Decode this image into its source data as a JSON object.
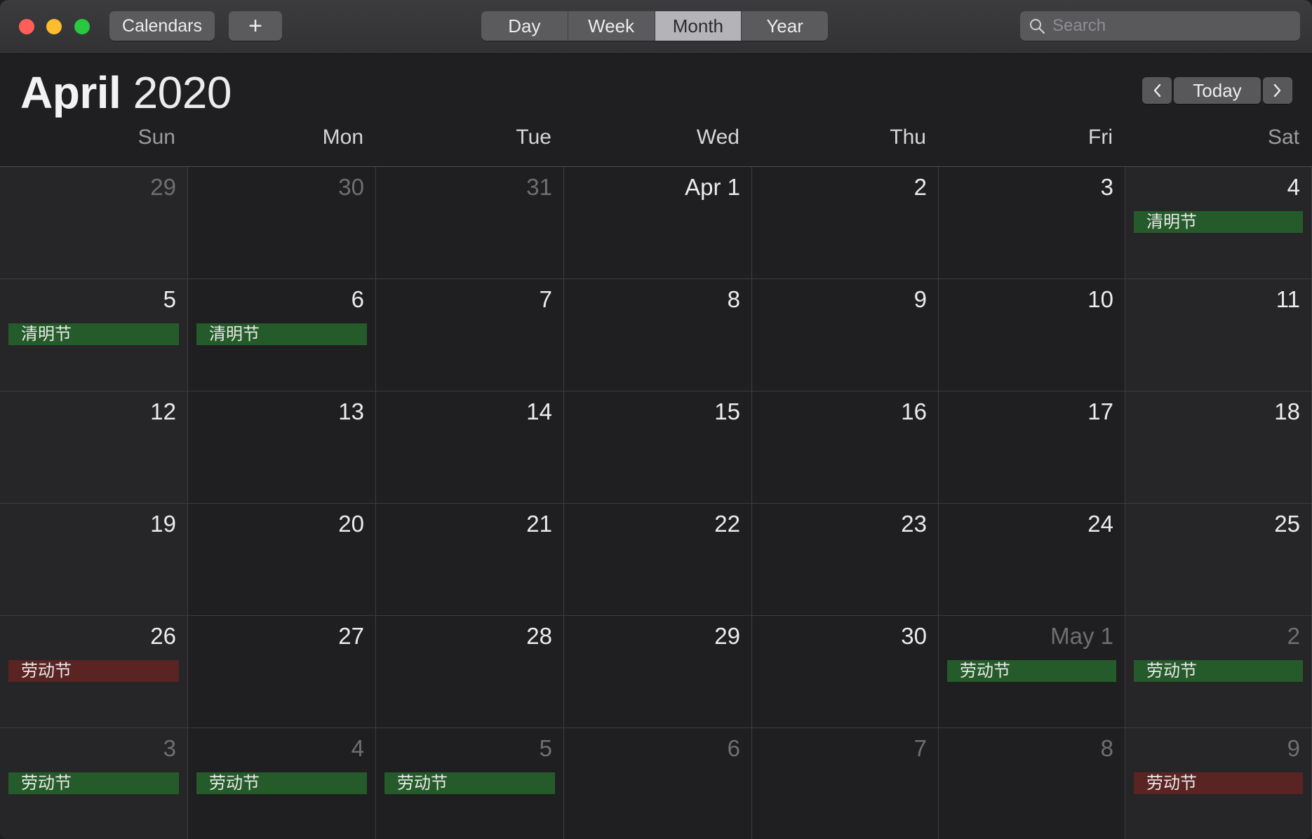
{
  "toolbar": {
    "calendars_label": "Calendars",
    "add_label": "+",
    "views": [
      "Day",
      "Week",
      "Month",
      "Year"
    ],
    "active_view": "Month",
    "search_placeholder": "Search"
  },
  "header": {
    "month": "April",
    "year": "2020",
    "today_label": "Today",
    "prev_label": "‹",
    "next_label": "›"
  },
  "weekdays": [
    "Sun",
    "Mon",
    "Tue",
    "Wed",
    "Thu",
    "Fri",
    "Sat"
  ],
  "weeks": [
    [
      {
        "label": "29",
        "other": true
      },
      {
        "label": "30",
        "other": true
      },
      {
        "label": "31",
        "other": true
      },
      {
        "label": "Apr 1",
        "other": false
      },
      {
        "label": "2",
        "other": false
      },
      {
        "label": "3",
        "other": false
      },
      {
        "label": "4",
        "other": false,
        "event": {
          "title": "清明节",
          "color": "green"
        }
      }
    ],
    [
      {
        "label": "5",
        "other": false,
        "event": {
          "title": "清明节",
          "color": "green"
        }
      },
      {
        "label": "6",
        "other": false,
        "event": {
          "title": "清明节",
          "color": "green"
        }
      },
      {
        "label": "7",
        "other": false
      },
      {
        "label": "8",
        "other": false
      },
      {
        "label": "9",
        "other": false
      },
      {
        "label": "10",
        "other": false
      },
      {
        "label": "11",
        "other": false
      }
    ],
    [
      {
        "label": "12",
        "other": false
      },
      {
        "label": "13",
        "other": false
      },
      {
        "label": "14",
        "other": false
      },
      {
        "label": "15",
        "other": false
      },
      {
        "label": "16",
        "other": false
      },
      {
        "label": "17",
        "other": false
      },
      {
        "label": "18",
        "other": false
      }
    ],
    [
      {
        "label": "19",
        "other": false
      },
      {
        "label": "20",
        "other": false
      },
      {
        "label": "21",
        "other": false
      },
      {
        "label": "22",
        "other": false
      },
      {
        "label": "23",
        "other": false
      },
      {
        "label": "24",
        "other": false
      },
      {
        "label": "25",
        "other": false
      }
    ],
    [
      {
        "label": "26",
        "other": false,
        "event": {
          "title": "劳动节",
          "color": "red"
        }
      },
      {
        "label": "27",
        "other": false
      },
      {
        "label": "28",
        "other": false
      },
      {
        "label": "29",
        "other": false
      },
      {
        "label": "30",
        "other": false
      },
      {
        "label": "May 1",
        "other": true,
        "event": {
          "title": "劳动节",
          "color": "green"
        }
      },
      {
        "label": "2",
        "other": true,
        "event": {
          "title": "劳动节",
          "color": "green"
        }
      }
    ],
    [
      {
        "label": "3",
        "other": true,
        "event": {
          "title": "劳动节",
          "color": "green"
        }
      },
      {
        "label": "4",
        "other": true,
        "event": {
          "title": "劳动节",
          "color": "green"
        }
      },
      {
        "label": "5",
        "other": true,
        "event": {
          "title": "劳动节",
          "color": "green"
        }
      },
      {
        "label": "6",
        "other": true
      },
      {
        "label": "7",
        "other": true
      },
      {
        "label": "8",
        "other": true
      },
      {
        "label": "9",
        "other": true,
        "event": {
          "title": "劳动节",
          "color": "red"
        }
      }
    ]
  ]
}
